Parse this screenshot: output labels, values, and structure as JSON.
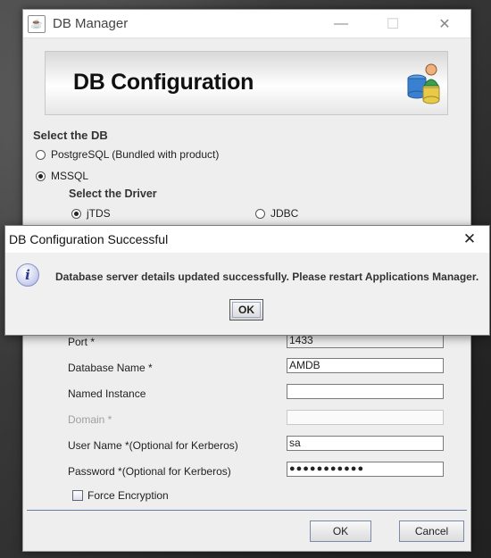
{
  "window": {
    "title": "DB Manager",
    "app_icon": "java-cup-icon",
    "controls": {
      "minimize": "—",
      "maximize": "☐",
      "close": "✕"
    }
  },
  "banner": {
    "title": "DB Configuration",
    "icon": "database-user-icon"
  },
  "select_db": {
    "heading": "Select the DB",
    "options": [
      {
        "label": "PostgreSQL (Bundled with product)",
        "selected": false
      },
      {
        "label": "MSSQL",
        "selected": true
      }
    ]
  },
  "select_driver": {
    "heading": "Select the Driver",
    "options": [
      {
        "label": "jTDS",
        "selected": true
      },
      {
        "label": "JDBC",
        "selected": false
      }
    ]
  },
  "form": {
    "port": {
      "label": "Port *",
      "value": "1433"
    },
    "database_name": {
      "label": "Database Name *",
      "value": "AMDB"
    },
    "named_instance": {
      "label": "Named Instance",
      "value": ""
    },
    "domain": {
      "label": "Domain *",
      "value": ""
    },
    "user_name": {
      "label": "User Name *(Optional for Kerberos)",
      "value": "sa"
    },
    "password": {
      "label": "Password *(Optional for Kerberos)",
      "value": "●●●●●●●●●●●"
    },
    "force_encryption": {
      "label": "Force Encryption",
      "checked": false
    }
  },
  "buttons": {
    "ok": "OK",
    "cancel": "Cancel"
  },
  "dialog": {
    "title": "DB Configuration Successful",
    "close": "✕",
    "icon_glyph": "i",
    "message": "Database server details updated successfully. Please restart Applications Manager.",
    "ok": "OK"
  }
}
